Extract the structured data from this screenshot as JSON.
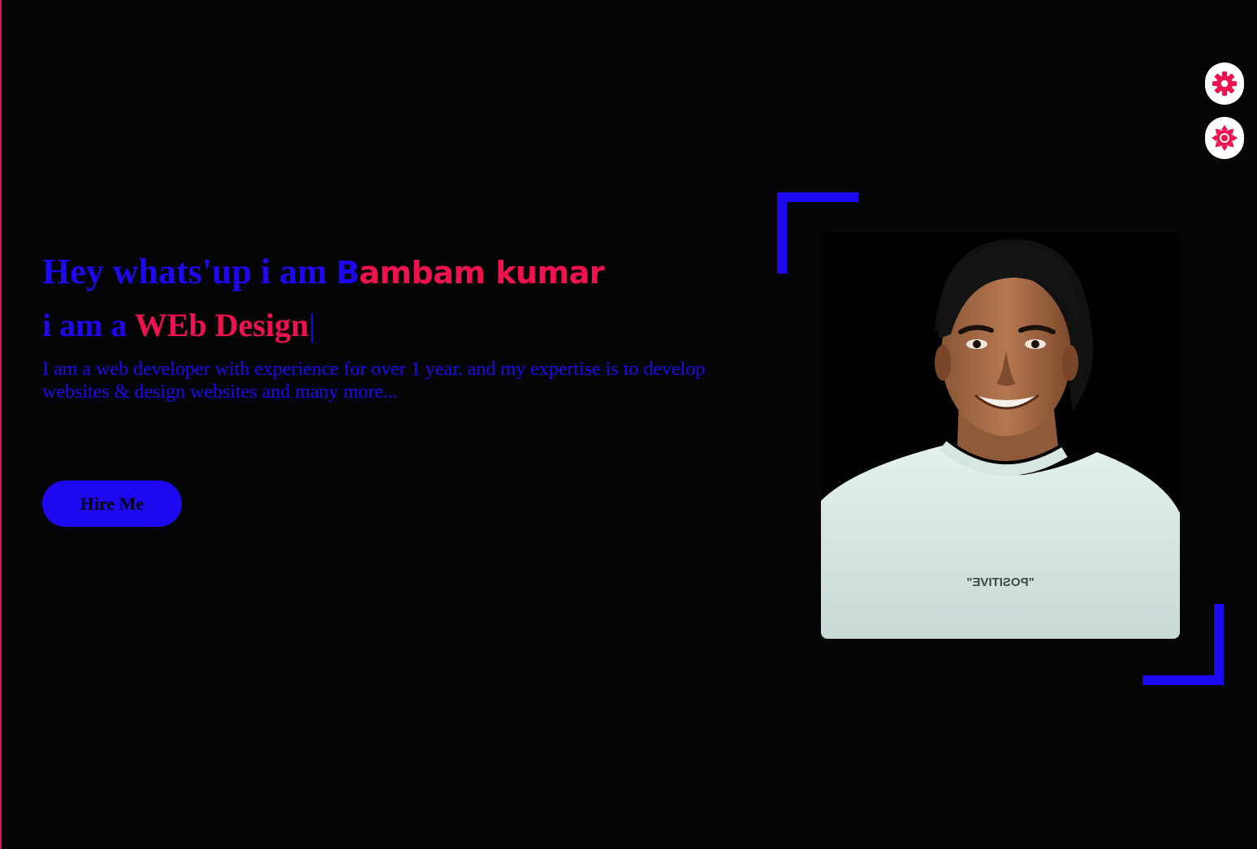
{
  "hero": {
    "greeting": "Hey whats'up i am ",
    "name_first_letter": "B",
    "name_rest": "ambam kumar",
    "role_prefix": "i am a ",
    "role_typed": "WEb Design",
    "role_caret": "|",
    "description": "I am a web developer with experience for over 1 year. and my expertise is to develop websites & design websites and many more..."
  },
  "cta": {
    "hire_label": "Hire Me"
  },
  "photo": {
    "shirt_text": "\"POSITIVE\""
  },
  "controls": {
    "settings_icon": "gear-icon",
    "theme_icon": "sun-icon"
  },
  "colors": {
    "background": "#050506",
    "primary_blue": "#1d08f0",
    "accent_pink": "#f0124e",
    "button_bg": "#ffffff"
  }
}
